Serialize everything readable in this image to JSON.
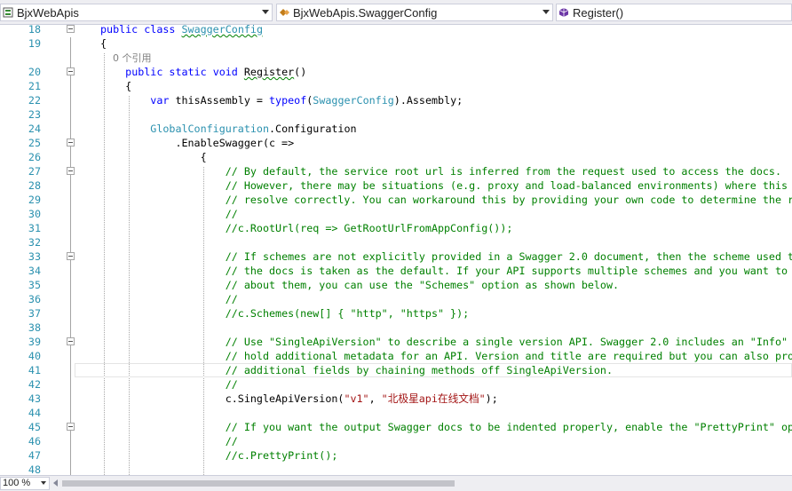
{
  "navbar": {
    "project": "BjxWebApis",
    "class_scope": "BjxWebApis.SwaggerConfig",
    "member": "Register()"
  },
  "editor": {
    "ref_hint": "0 个引用",
    "lines": [
      {
        "n": "18",
        "fold": true,
        "segs": [
          [
            "kw",
            "public "
          ],
          [
            "kw",
            "class "
          ],
          [
            "tysq",
            "SwaggerConfig"
          ]
        ]
      },
      {
        "n": "19",
        "segs": [
          [
            "",
            "{"
          ]
        ]
      },
      {
        "n": "",
        "ref": true,
        "segs": [
          [
            "ref",
            "    0 个引用"
          ]
        ]
      },
      {
        "n": "20",
        "fold": true,
        "segs": [
          [
            "",
            "    "
          ],
          [
            "kw",
            "public "
          ],
          [
            "kw",
            "static "
          ],
          [
            "kw",
            "void "
          ],
          [
            "sq",
            "Register"
          ],
          [
            "",
            "()"
          ]
        ]
      },
      {
        "n": "21",
        "segs": [
          [
            "",
            "    {"
          ]
        ]
      },
      {
        "n": "22",
        "segs": [
          [
            "",
            "        "
          ],
          [
            "kw",
            "var"
          ],
          [
            "",
            " thisAssembly = "
          ],
          [
            "kw",
            "typeof"
          ],
          [
            "",
            "("
          ],
          [
            "ty",
            "SwaggerConfig"
          ],
          [
            "",
            ").Assembly;"
          ]
        ]
      },
      {
        "n": "23",
        "segs": []
      },
      {
        "n": "24",
        "segs": [
          [
            "",
            "        "
          ],
          [
            "ty",
            "GlobalConfiguration"
          ],
          [
            "",
            ".Configuration"
          ]
        ]
      },
      {
        "n": "25",
        "fold": true,
        "segs": [
          [
            "",
            "            .EnableSwagger(c =>"
          ]
        ]
      },
      {
        "n": "26",
        "segs": [
          [
            "",
            "                {"
          ]
        ]
      },
      {
        "n": "27",
        "fold": true,
        "segs": [
          [
            "",
            "                    "
          ],
          [
            "cm",
            "// By default, the service root url is inferred from the request used to access the docs."
          ]
        ]
      },
      {
        "n": "28",
        "segs": [
          [
            "",
            "                    "
          ],
          [
            "cm",
            "// However, there may be situations (e.g. proxy and load-balanced environments) where this does not"
          ]
        ]
      },
      {
        "n": "29",
        "segs": [
          [
            "",
            "                    "
          ],
          [
            "cm",
            "// resolve correctly. You can workaround this by providing your own code to determine the root URL."
          ]
        ]
      },
      {
        "n": "30",
        "segs": [
          [
            "",
            "                    "
          ],
          [
            "cm",
            "//"
          ]
        ]
      },
      {
        "n": "31",
        "segs": [
          [
            "",
            "                    "
          ],
          [
            "cm",
            "//c.RootUrl(req => GetRootUrlFromAppConfig());"
          ]
        ]
      },
      {
        "n": "32",
        "segs": []
      },
      {
        "n": "33",
        "fold": true,
        "segs": [
          [
            "",
            "                    "
          ],
          [
            "cm",
            "// If schemes are not explicitly provided in a Swagger 2.0 document, then the scheme used to access"
          ]
        ]
      },
      {
        "n": "34",
        "segs": [
          [
            "",
            "                    "
          ],
          [
            "cm",
            "// the docs is taken as the default. If your API supports multiple schemes and you want to be explicit"
          ]
        ]
      },
      {
        "n": "35",
        "segs": [
          [
            "",
            "                    "
          ],
          [
            "cm",
            "// about them, you can use the \"Schemes\" option as shown below."
          ]
        ]
      },
      {
        "n": "36",
        "segs": [
          [
            "",
            "                    "
          ],
          [
            "cm",
            "//"
          ]
        ]
      },
      {
        "n": "37",
        "segs": [
          [
            "",
            "                    "
          ],
          [
            "cm",
            "//c.Schemes(new[] { \"http\", \"https\" });"
          ]
        ]
      },
      {
        "n": "38",
        "segs": []
      },
      {
        "n": "39",
        "fold": true,
        "segs": [
          [
            "",
            "                    "
          ],
          [
            "cm",
            "// Use \"SingleApiVersion\" to describe a single version API. Swagger 2.0 includes an \"Info\" object to"
          ]
        ]
      },
      {
        "n": "40",
        "segs": [
          [
            "",
            "                    "
          ],
          [
            "cm",
            "// hold additional metadata for an API. Version and title are required but you can also provide"
          ]
        ]
      },
      {
        "n": "41",
        "cur": true,
        "segs": [
          [
            "",
            "                    "
          ],
          [
            "cm",
            "// additional fields by chaining methods off SingleApiVersion."
          ]
        ]
      },
      {
        "n": "42",
        "segs": [
          [
            "",
            "                    "
          ],
          [
            "cm",
            "//"
          ]
        ]
      },
      {
        "n": "43",
        "segs": [
          [
            "",
            "                    c.SingleApiVersion("
          ],
          [
            "st",
            "\"v1\""
          ],
          [
            "",
            ", "
          ],
          [
            "st",
            "\"北极星api在线文档\""
          ],
          [
            "",
            ");"
          ]
        ]
      },
      {
        "n": "44",
        "segs": []
      },
      {
        "n": "45",
        "fold": true,
        "segs": [
          [
            "",
            "                    "
          ],
          [
            "cm",
            "// If you want the output Swagger docs to be indented properly, enable the \"PrettyPrint\" option."
          ]
        ]
      },
      {
        "n": "46",
        "segs": [
          [
            "",
            "                    "
          ],
          [
            "cm",
            "//"
          ]
        ]
      },
      {
        "n": "47",
        "segs": [
          [
            "",
            "                    "
          ],
          [
            "cm",
            "//c.PrettyPrint();"
          ]
        ]
      },
      {
        "n": "48",
        "segs": []
      }
    ]
  },
  "statusbar": {
    "zoom": "100 %"
  },
  "colors": {
    "keyword": "#0000ff",
    "type": "#2b91af",
    "comment": "#008000",
    "string": "#a31515",
    "line_number": "#2b91af"
  }
}
